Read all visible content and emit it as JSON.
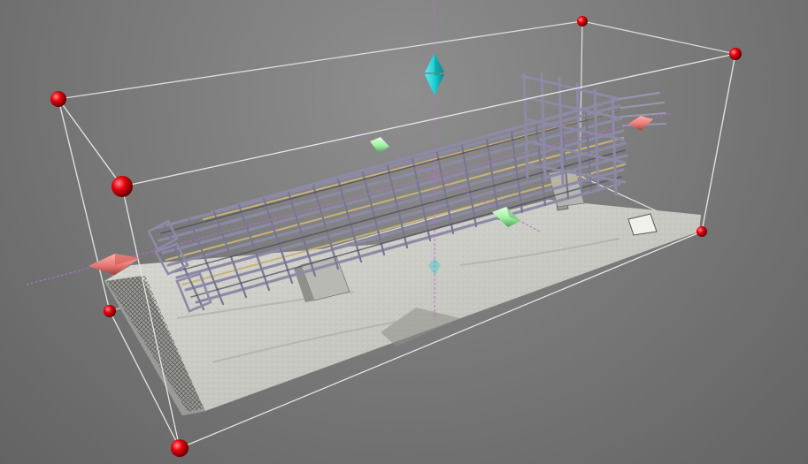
{
  "viewport": {
    "background_color": "#7a7a7a",
    "bounding_box_color": "#e6e6e6",
    "handle_color": "#e8000d",
    "axis_color": "#b070d0"
  },
  "gizmo": {
    "vertical_arrow_color": "#19c9cf",
    "horizontal_arrow_color": "#e87a74",
    "depth_arrow_color": "#9ef0a0"
  },
  "model": {
    "slab_color": "#c9c9c3",
    "rebar_color": "#8d8aa6",
    "bar_accent_color": "#c8b27a"
  }
}
